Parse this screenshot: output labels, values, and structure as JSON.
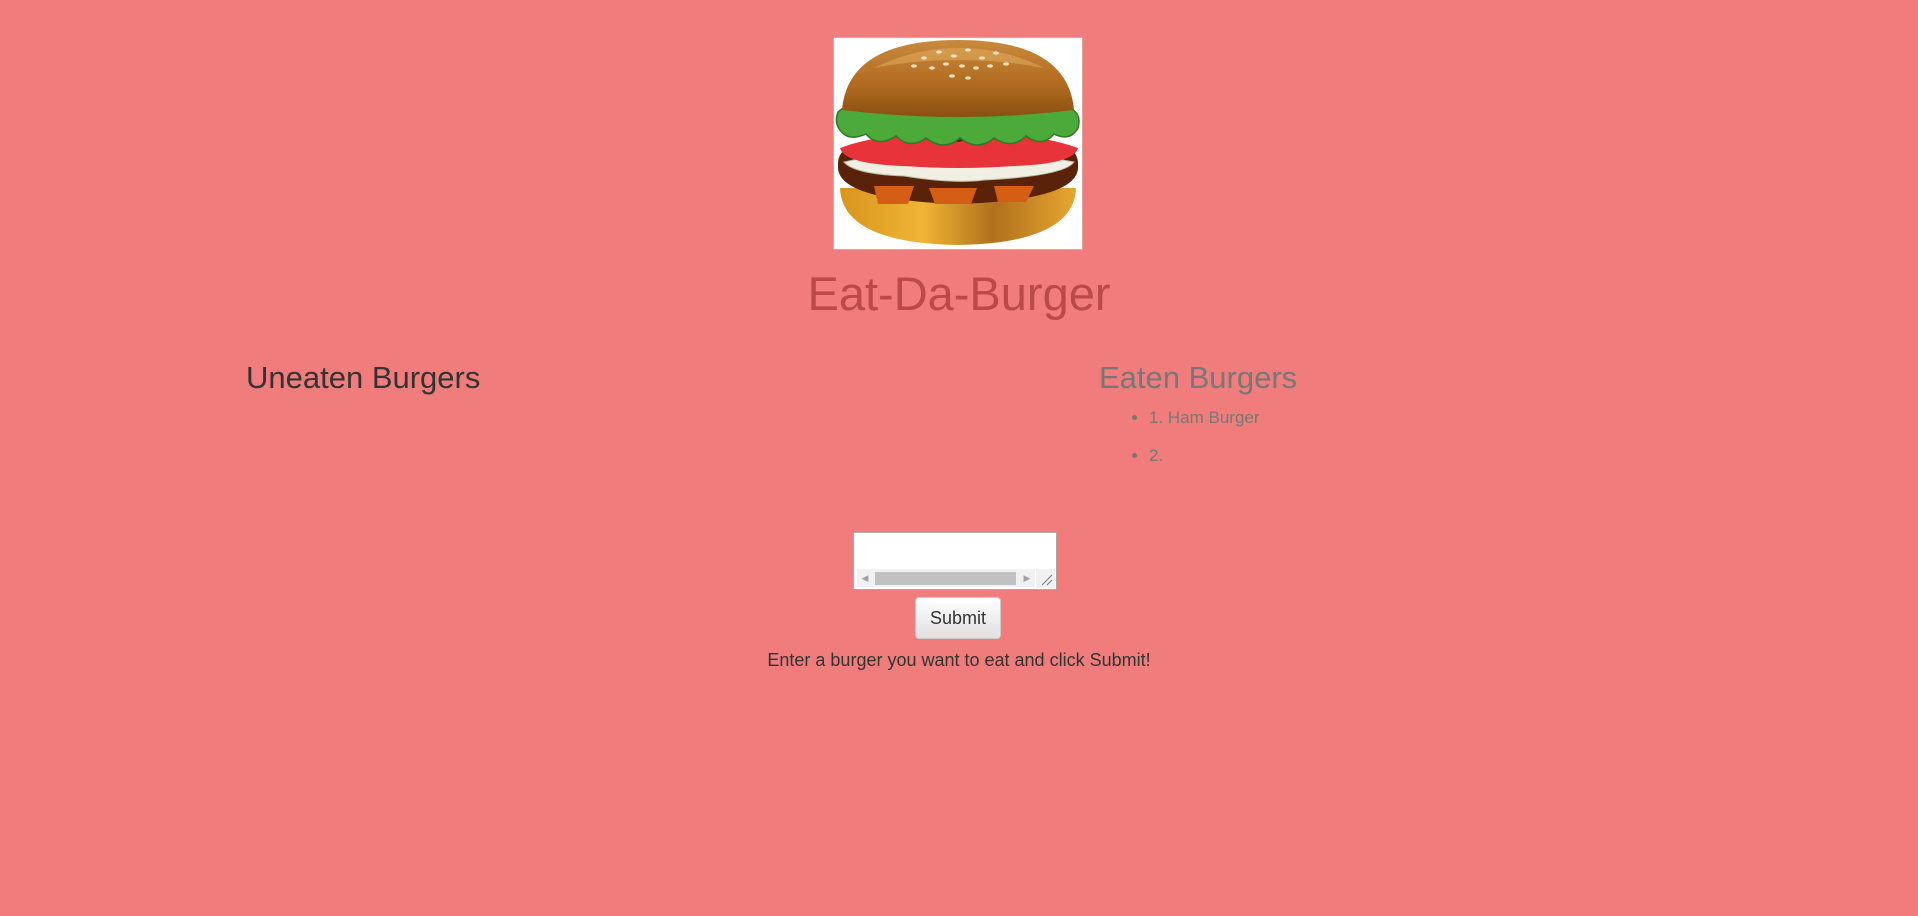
{
  "page": {
    "title": "Eat-Da-Burger",
    "background_color": "#f07c7c",
    "title_color": "#b94a48"
  },
  "hero": {
    "image": "hamburger-illustration"
  },
  "uneaten": {
    "heading": "Uneaten Burgers",
    "items": []
  },
  "eaten": {
    "heading": "Eaten Burgers",
    "items": [
      {
        "label": "1. Ham Burger"
      },
      {
        "label": "2."
      }
    ]
  },
  "form": {
    "input_value": "",
    "submit_label": "Submit",
    "hint": "Enter a burger you want to eat and click Submit!"
  }
}
